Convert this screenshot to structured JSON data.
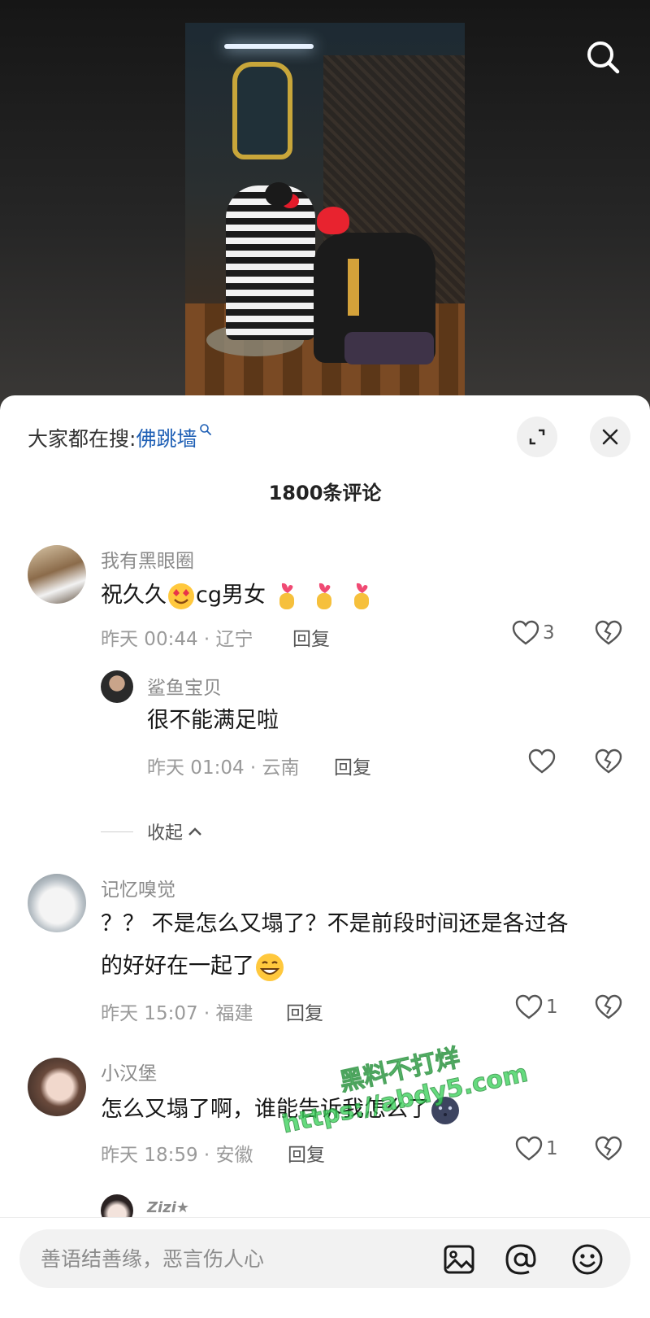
{
  "trending": {
    "prefix": "大家都在搜:",
    "term": "佛跳墙"
  },
  "comment_count": "1800条评论",
  "comments": [
    {
      "user": "我有黑眼圈",
      "text": "祝久久",
      "text2": "cg男女",
      "time": "昨天 00:44 · 辽宁",
      "reply": "回复",
      "likes": "3"
    },
    {
      "user": "鲨鱼宝贝",
      "text": "很不能满足啦",
      "time": "昨天 01:04 · 云南",
      "reply": "回复",
      "likes": ""
    },
    {
      "user": "记忆嗅觉",
      "text": "？？ 不是怎么又塌了？不是前段时间还是各过各",
      "text_line2": "的好好在一起了",
      "time": "昨天 15:07 · 福建",
      "reply": "回复",
      "likes": "1"
    },
    {
      "user": "小汉堡",
      "text": "怎么又塌了啊，谁能告诉我怎么了",
      "time": "昨天 18:59 · 安徽",
      "reply": "回复",
      "likes": "1"
    },
    {
      "user": "Zizi★"
    }
  ],
  "collapse_label": "收起",
  "input": {
    "placeholder": "善语结善缘，恶言伤人心"
  },
  "watermark": {
    "line1": "黑料不打烊",
    "line2": "https://abdy5.com"
  },
  "colors": {
    "accent_link": "#1e5fb5",
    "sheet_bg": "#ffffff",
    "watermark": "#3ad25a"
  },
  "icons": [
    "search-icon",
    "expand-icon",
    "close-icon",
    "heart-icon",
    "dislike-icon",
    "image-icon",
    "at-icon",
    "emoji-icon"
  ]
}
